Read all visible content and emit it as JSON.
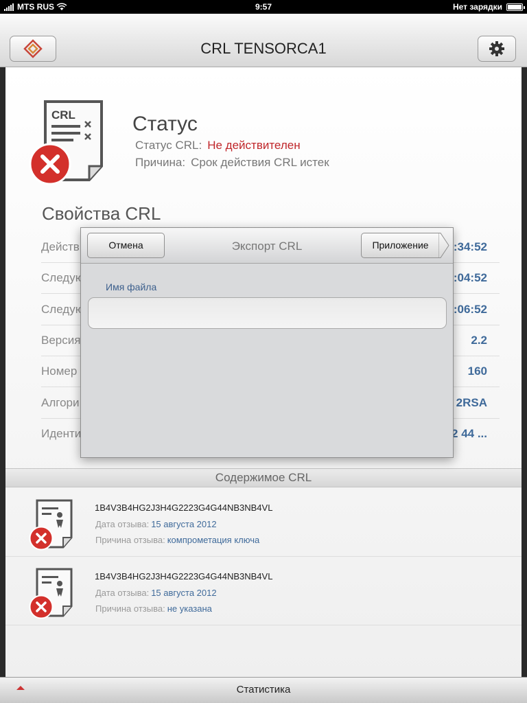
{
  "status_bar": {
    "carrier": "MTS RUS",
    "time": "9:57",
    "battery_text": "Нет зарядки"
  },
  "nav": {
    "title": "CRL TENSORCA1"
  },
  "status": {
    "title": "Статус",
    "crl_status_label": "Статус CRL:",
    "crl_status_value": "Не действителен",
    "reason_label": "Причина:",
    "reason_value": "Срок действия CRL истек",
    "status_color": "#c0262a"
  },
  "properties": {
    "title": "Свойства CRL",
    "rows": [
      {
        "label": "Действ",
        "value": ":34:52"
      },
      {
        "label": "Следую",
        "value": ":04:52"
      },
      {
        "label": "Следую",
        "value": ":06:52"
      },
      {
        "label": "Версия",
        "value": "2.2"
      },
      {
        "label": "Номер",
        "value": "160"
      },
      {
        "label": "Алгори",
        "value": "2RSA"
      },
      {
        "label": "Иденти",
        "value": "2 44 ..."
      }
    ]
  },
  "contents": {
    "title": "Содержимое CRL",
    "items": [
      {
        "serial": "1B4V3B4HG2J3H4G2223G4G44NB3NB4VL",
        "date_label": "Дата отзыва:",
        "date_value": "15 августа 2012",
        "reason_label": "Причина отзыва:",
        "reason_value": "компрометация ключа"
      },
      {
        "serial": "1B4V3B4HG2J3H4G2223G4G44NB3NB4VL",
        "date_label": "Дата отзыва:",
        "date_value": "15 августа 2012",
        "reason_label": "Причина отзыва:",
        "reason_value": "не указана"
      }
    ]
  },
  "bottom_bar": {
    "label": "Статистика"
  },
  "dialog": {
    "title": "Экспорт CRL",
    "cancel_label": "Отмена",
    "app_label": "Приложение",
    "field_label": "Имя файла",
    "field_value": ""
  },
  "colors": {
    "accent_blue": "#3f6a9a",
    "error_red": "#c0262a"
  },
  "icons": [
    "wifi-icon",
    "app-logo-icon",
    "gear-icon",
    "crl-document-icon",
    "error-icon",
    "certificate-icon",
    "expand-arrow-icon"
  ]
}
